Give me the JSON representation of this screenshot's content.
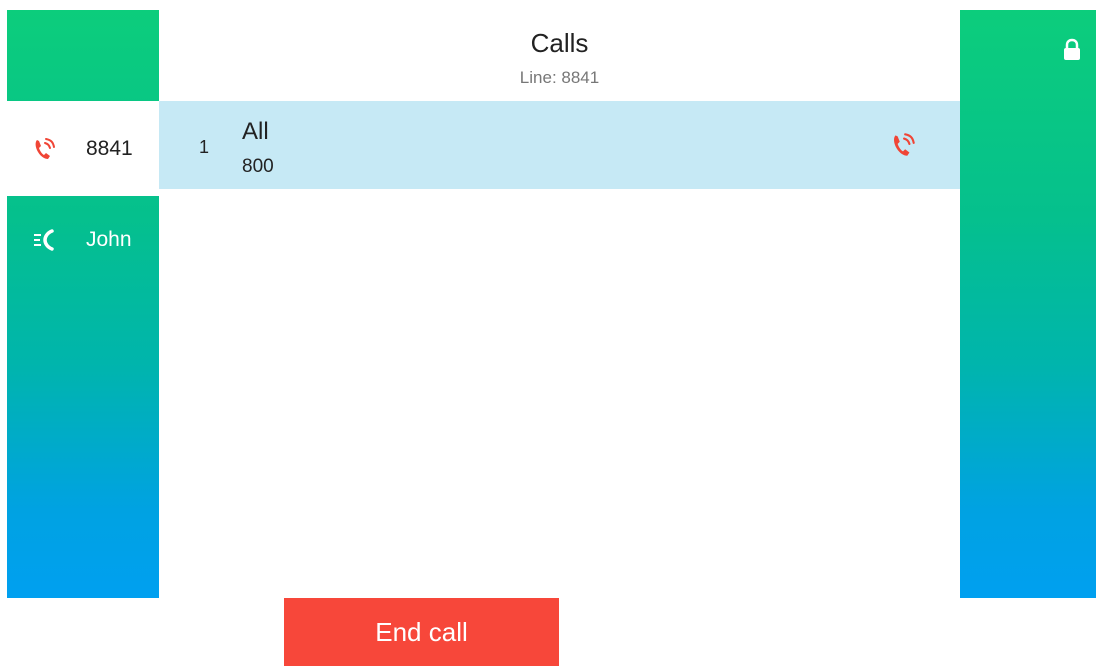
{
  "header": {
    "title": "Calls",
    "subtitle": "Line: 8841"
  },
  "line_keys": [
    {
      "label": "8841",
      "icon": "ringing-phone-icon",
      "color": "#f04536"
    },
    {
      "label": "John",
      "icon": "call-list-icon",
      "color": "#ffffff"
    }
  ],
  "calls": [
    {
      "index": "1",
      "name": "All",
      "number": "800",
      "status_icon": "ringing-phone-icon"
    }
  ],
  "colors": {
    "accent_green": "#0ccd7c",
    "accent_blue": "#00a0f0",
    "selected_row": "#c6e9f5",
    "end_call": "#f7473a",
    "alert_red": "#f04536"
  },
  "status": {
    "lock_icon": "lock-icon"
  },
  "softkeys": {
    "end_call": "End call"
  }
}
